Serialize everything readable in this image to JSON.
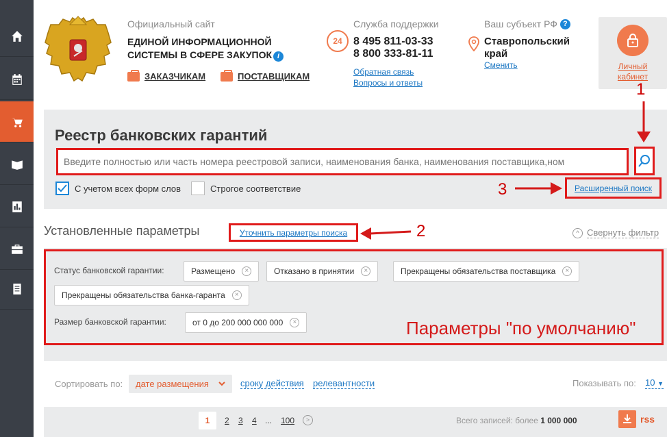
{
  "sidebar": {
    "items": [
      {
        "icon": "home-icon"
      },
      {
        "icon": "calendar-icon"
      },
      {
        "icon": "cart-icon",
        "active": true
      },
      {
        "icon": "book-icon"
      },
      {
        "icon": "report-icon"
      },
      {
        "icon": "briefcase-icon"
      },
      {
        "icon": "document-icon"
      }
    ]
  },
  "header": {
    "site_pre": "Официальный сайт",
    "site_name_line1": "ЕДИНОЙ ИНФОРМАЦИОННОЙ",
    "site_name_line2": "СИСТЕМЫ В СФЕРЕ ЗАКУПОК",
    "customers_link": "ЗАКАЗЧИКАМ",
    "suppliers_link": "ПОСТАВЩИКАМ",
    "support_label": "Служба поддержки",
    "support_icon_text": "24",
    "phone1": "8 495 811-03-33",
    "phone2": "8 800 333-81-11",
    "feedback_link": "Обратная связь",
    "faq_link": "Вопросы и ответы",
    "region_label": "Ваш субъект РФ",
    "region_line1": "Ставропольский",
    "region_line2": "край",
    "region_change": "Сменить",
    "cabinet_line1": "Личный",
    "cabinet_line2": "кабинет"
  },
  "search": {
    "title": "Реестр банковских гарантий",
    "placeholder": "Введите полностью или часть номера реестровой записи, наименования банка, наименования поставщика,ном",
    "check_all_forms": "С учетом всех форм слов",
    "check_all_forms_checked": true,
    "check_strict": "Строгое соответствие",
    "check_strict_checked": false,
    "advanced_link": "Расширенный поиск"
  },
  "annotations": {
    "n1": "1",
    "n2": "2",
    "n3": "3",
    "default_note": "Параметры \"по умолчанию\""
  },
  "params": {
    "title": "Установленные параметры",
    "refine_link": "Уточнить параметры поиска",
    "collapse": "Свернуть фильтр",
    "status_label": "Статус банковской гарантии:",
    "status_chips": [
      "Размещено",
      "Отказано в принятии",
      "Прекращены обязательства поставщика",
      "Прекращены обязательства банка-гаранта"
    ],
    "size_label": "Размер банковской гарантии:",
    "size_chip": "от 0 до 200 000 000 000"
  },
  "sorting": {
    "label": "Сортировать по:",
    "selected": "дате размещения",
    "option2": "сроку действия",
    "option3": "релевантности",
    "show_label": "Показывать по:",
    "show_value": "10"
  },
  "pagination": {
    "pages": [
      "1",
      "2",
      "3",
      "4",
      "...",
      "100"
    ],
    "current": "1",
    "total_label": "Всего записей: более",
    "total_value": "1 000 000",
    "rss": "rss"
  }
}
